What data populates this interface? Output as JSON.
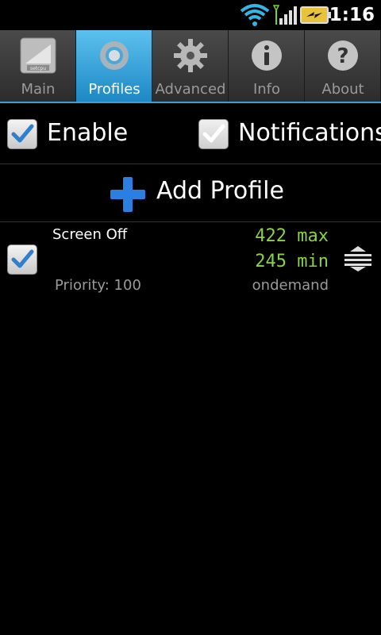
{
  "status_bar": {
    "time": "1:16",
    "wifi_icon": "wifi-icon",
    "signal_icon": "signal-icon",
    "battery_icon": "battery-charging-icon"
  },
  "tabs": [
    {
      "label": "Main",
      "icon": "setcpu-logo-icon",
      "active": false
    },
    {
      "label": "Profiles",
      "icon": "profiles-ring-icon",
      "active": true
    },
    {
      "label": "Advanced",
      "icon": "gear-icon",
      "active": false
    },
    {
      "label": "Info",
      "icon": "info-icon",
      "active": false
    },
    {
      "label": "About",
      "icon": "question-icon",
      "active": false
    }
  ],
  "options": {
    "enable": {
      "label": "Enable",
      "checked": true
    },
    "notifications": {
      "label": "Notifications",
      "checked": false
    }
  },
  "add_profile": {
    "label": "Add Profile",
    "icon": "plus-icon"
  },
  "profiles": [
    {
      "name": "Screen Off",
      "max": "422 max",
      "min": "245 min",
      "priority": "Priority: 100",
      "governor": "ondemand",
      "checked": true
    }
  ],
  "colors": {
    "accent": "#3aa0d6",
    "freq_text": "#8ad43f",
    "secondary_text": "#9a9a9a",
    "plus_blue": "#2a7fe0"
  }
}
